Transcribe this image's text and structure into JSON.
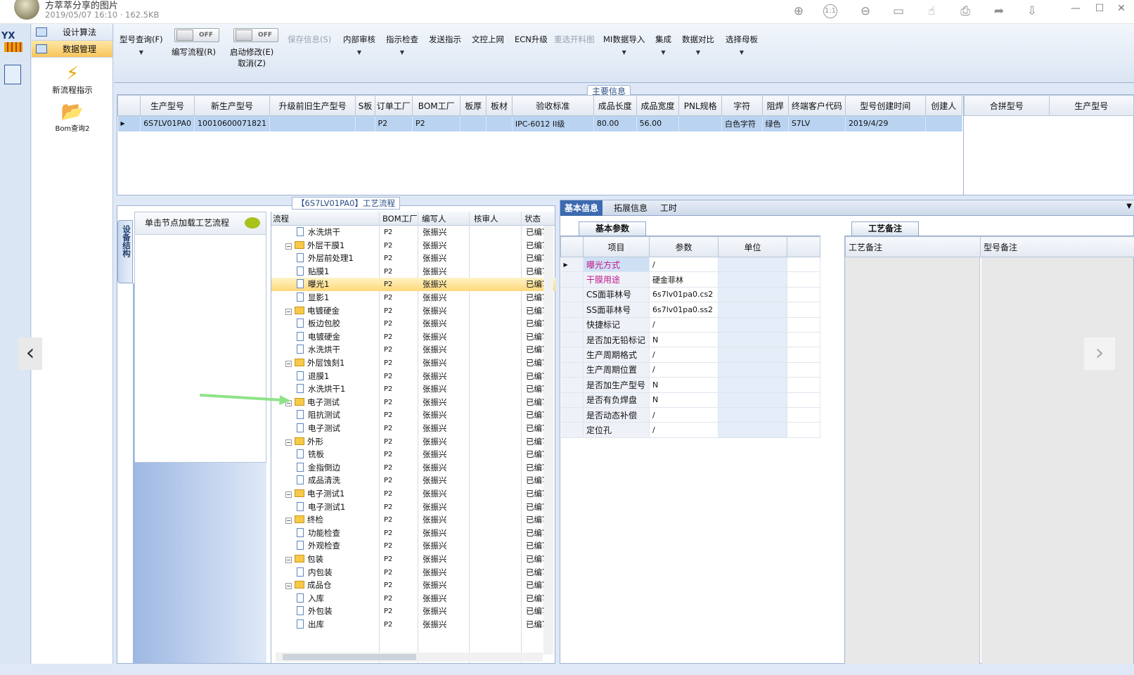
{
  "viewer": {
    "title": "方萃萃分享的图片",
    "meta": "2019/05/07 16:10 · 162.5KB",
    "tools": [
      "zoom-in-icon",
      "actual-size-icon",
      "zoom-out-icon",
      "rotate-icon",
      "hand-icon",
      "print-icon",
      "share-icon",
      "download-icon"
    ],
    "actual_size_glyph": "1:1"
  },
  "nav": {
    "tabs": [
      {
        "label": "设计算法"
      },
      {
        "label": "数据管理",
        "active": true
      }
    ],
    "items": [
      {
        "label": "新流程指示",
        "icon": "lightning-icon"
      },
      {
        "label": "Bom查询2",
        "icon": "folder-icon"
      }
    ],
    "logo_text": "YX"
  },
  "toolbar": {
    "buttons": [
      {
        "label": "型号查询(F)",
        "has_menu": true,
        "enabled": true
      },
      {
        "label": "编写流程(R)",
        "enabled": true
      },
      {
        "label": "启动修改(E)",
        "sub": "取消(Z)",
        "enabled": true
      },
      {
        "label": "保存信息(S)",
        "enabled": false
      },
      {
        "label": "内部审核",
        "has_menu": true,
        "enabled": true
      },
      {
        "label": "指示检查",
        "has_menu": true,
        "enabled": true
      },
      {
        "label": "发送指示",
        "enabled": true
      },
      {
        "label": "文控上网",
        "enabled": true
      },
      {
        "label": "ECN升级",
        "enabled": true
      },
      {
        "label": "重选开料图",
        "enabled": false
      },
      {
        "label": "MI数据导入",
        "has_menu": true,
        "enabled": true
      },
      {
        "label": "集成",
        "has_menu": true,
        "enabled": true
      },
      {
        "label": "数据对比",
        "has_menu": true,
        "enabled": true
      },
      {
        "label": "选择母板",
        "has_menu": true,
        "enabled": true
      }
    ],
    "toggle_write": "OFF",
    "toggle_modify": "OFF"
  },
  "main_info": {
    "title": "主要信息",
    "columns": [
      "生产型号",
      "新生产型号",
      "升级前旧生产型号",
      "S板",
      "订单工厂",
      "BOM工厂",
      "板厚",
      "板材",
      "验收标准",
      "成品长度",
      "成品宽度",
      "PNL规格",
      "字符",
      "阻焊",
      "终端客户代码",
      "型号创建时间",
      "创建人"
    ],
    "row": [
      "6S7LV01PA0",
      "10010600071821",
      "",
      "",
      "P2",
      "P2",
      "",
      "",
      "IPC-6012 II级",
      "80.00",
      "56.00",
      "",
      "白色字符",
      "绿色",
      "S7LV",
      "2019/4/29",
      ""
    ],
    "merge_columns": [
      "合拼型号",
      "生产型号"
    ]
  },
  "process": {
    "title": "【6S7LV01PA0】工艺流程",
    "equip_tab": "设备结构",
    "click_hint": "单击节点加载工艺流程",
    "columns": [
      "流程",
      "BOM工厂",
      "编写人",
      "核审人",
      "状态"
    ],
    "rows": [
      {
        "name": "水洗烘干",
        "level": 2,
        "bom": "P2",
        "writer": "张振兴",
        "status": "已编写"
      },
      {
        "name": "外层干膜1",
        "level": 1,
        "bom": "P2",
        "writer": "张振兴",
        "status": "已编写"
      },
      {
        "name": "外层前处理1",
        "level": 2,
        "bom": "P2",
        "writer": "张振兴",
        "status": "已编写"
      },
      {
        "name": "贴膜1",
        "level": 2,
        "bom": "P2",
        "writer": "张振兴",
        "status": "已编写"
      },
      {
        "name": "曝光1",
        "level": 2,
        "bom": "P2",
        "writer": "张振兴",
        "status": "已编写",
        "selected": true
      },
      {
        "name": "显影1",
        "level": 2,
        "bom": "P2",
        "writer": "张振兴",
        "status": "已编写"
      },
      {
        "name": "电镀硬金",
        "level": 1,
        "bom": "P2",
        "writer": "张振兴",
        "status": "已编写"
      },
      {
        "name": "板边包胶",
        "level": 2,
        "bom": "P2",
        "writer": "张振兴",
        "status": "已编写"
      },
      {
        "name": "电镀硬金",
        "level": 2,
        "bom": "P2",
        "writer": "张振兴",
        "status": "已编写"
      },
      {
        "name": "水洗烘干",
        "level": 2,
        "bom": "P2",
        "writer": "张振兴",
        "status": "已编写"
      },
      {
        "name": "外层蚀刻1",
        "level": 1,
        "bom": "P2",
        "writer": "张振兴",
        "status": "已编写"
      },
      {
        "name": "退膜1",
        "level": 2,
        "bom": "P2",
        "writer": "张振兴",
        "status": "已编写"
      },
      {
        "name": "水洗烘干1",
        "level": 2,
        "bom": "P2",
        "writer": "张振兴",
        "status": "已编写"
      },
      {
        "name": "电子测试",
        "level": 1,
        "bom": "P2",
        "writer": "张振兴",
        "status": "已编写"
      },
      {
        "name": "阻抗测试",
        "level": 2,
        "bom": "P2",
        "writer": "张振兴",
        "status": "已编写"
      },
      {
        "name": "电子测试",
        "level": 2,
        "bom": "P2",
        "writer": "张振兴",
        "status": "已编写"
      },
      {
        "name": "外形",
        "level": 1,
        "bom": "P2",
        "writer": "张振兴",
        "status": "已编写"
      },
      {
        "name": "铣板",
        "level": 2,
        "bom": "P2",
        "writer": "张振兴",
        "status": "已编写"
      },
      {
        "name": "金指倒边",
        "level": 2,
        "bom": "P2",
        "writer": "张振兴",
        "status": "已编写"
      },
      {
        "name": "成品清洗",
        "level": 2,
        "bom": "P2",
        "writer": "张振兴",
        "status": "已编写"
      },
      {
        "name": "电子测试1",
        "level": 1,
        "bom": "P2",
        "writer": "张振兴",
        "status": "已编写"
      },
      {
        "name": "电子测试1",
        "level": 2,
        "bom": "P2",
        "writer": "张振兴",
        "status": "已编写"
      },
      {
        "name": "终检",
        "level": 1,
        "bom": "P2",
        "writer": "张振兴",
        "status": "已编写"
      },
      {
        "name": "功能检查",
        "level": 2,
        "bom": "P2",
        "writer": "张振兴",
        "status": "已编写"
      },
      {
        "name": "外观检查",
        "level": 2,
        "bom": "P2",
        "writer": "张振兴",
        "status": "已编写"
      },
      {
        "name": "包装",
        "level": 1,
        "bom": "P2",
        "writer": "张振兴",
        "status": "已编写"
      },
      {
        "name": "内包装",
        "level": 2,
        "bom": "P2",
        "writer": "张振兴",
        "status": "已编写"
      },
      {
        "name": "成品仓",
        "level": 1,
        "bom": "P2",
        "writer": "张振兴",
        "status": "已编写"
      },
      {
        "name": "入库",
        "level": 2,
        "bom": "P2",
        "writer": "张振兴",
        "status": "已编写"
      },
      {
        "name": "外包装",
        "level": 2,
        "bom": "P2",
        "writer": "张振兴",
        "status": "已编写"
      },
      {
        "name": "出库",
        "level": 2,
        "bom": "P2",
        "writer": "张振兴",
        "status": "已编写"
      }
    ]
  },
  "detail": {
    "tabs": [
      {
        "label": "基本信息",
        "active": true
      },
      {
        "label": "拓展信息"
      },
      {
        "label": "工时"
      }
    ],
    "basic_title": "基本参数",
    "basic_columns": [
      "项目",
      "参数",
      "单位"
    ],
    "basic_rows": [
      {
        "item": "曝光方式",
        "value": "/",
        "highlight": true,
        "pink": true
      },
      {
        "item": "干膜用途",
        "value": "硬金菲林",
        "pink": true
      },
      {
        "item": "CS面菲林号",
        "value": "6s7lv01pa0.cs2"
      },
      {
        "item": "SS面菲林号",
        "value": "6s7lv01pa0.ss2"
      },
      {
        "item": "快捷标记",
        "value": "/"
      },
      {
        "item": "是否加无铅标记",
        "value": "N"
      },
      {
        "item": "生产周期格式",
        "value": "/"
      },
      {
        "item": "生产周期位置",
        "value": "/"
      },
      {
        "item": "是否加生产型号",
        "value": "N"
      },
      {
        "item": "是否有负焊盘",
        "value": "N"
      },
      {
        "item": "是否动态补偿",
        "value": "/"
      },
      {
        "item": "定位孔",
        "value": "/"
      }
    ],
    "remark_title": "工艺备注",
    "remark_columns": [
      "工艺备注",
      "型号备注"
    ]
  }
}
